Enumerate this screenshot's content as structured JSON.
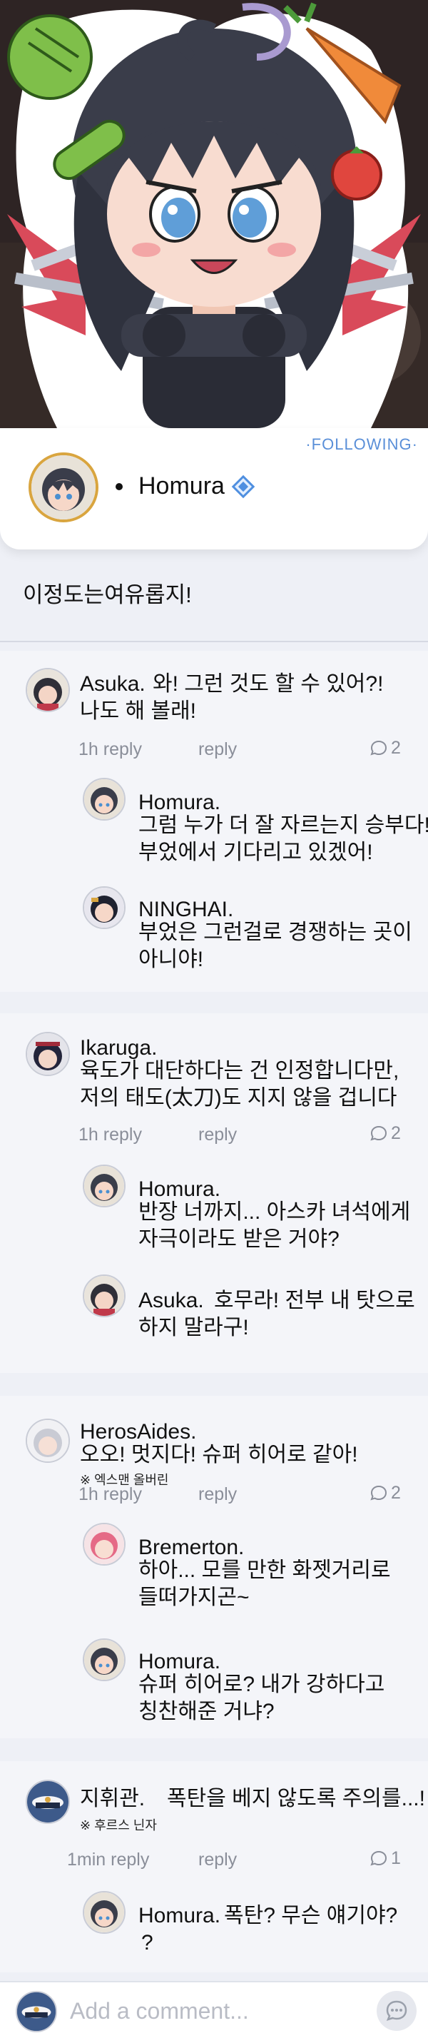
{
  "header": {
    "following_label": "·FOLLOWING·",
    "name": "Homura"
  },
  "post": {
    "text": "이정도는여유롭지!"
  },
  "threads": [
    {
      "comment": {
        "name": "Asuka.",
        "text_line1": "와! 그런 것도 할 수 있어?!",
        "text_line2": "나도 해 볼래!"
      },
      "time": "1h reply",
      "reply_label": "reply",
      "reply_count": "2",
      "replies": [
        {
          "name": "Homura.",
          "line1": "그럼 누가 더 잘 자르는지 승부다!",
          "line2": "부었에서 기다리고 있겠어!"
        },
        {
          "name": "NINGHAI.",
          "line1": "부었은 그런걸로 경쟁하는 곳이",
          "line2": "아니야!"
        }
      ]
    },
    {
      "comment": {
        "name": "Ikaruga.",
        "text_line1": "육도가 대단하다는 건 인정합니다만,",
        "text_line2": "저의 태도(太刀)도 지지 않을 겁니다"
      },
      "time": "1h reply",
      "reply_label": "reply",
      "reply_count": "2",
      "replies": [
        {
          "name": "Homura.",
          "line1": "반장 너까지... 아스카 녀석에게",
          "line2": "자극이라도 받은 거야?"
        },
        {
          "name": "Asuka.",
          "line1": "호무라! 전부 내 탓으로",
          "line2": "하지 말라구!"
        }
      ]
    },
    {
      "comment": {
        "name": "HerosAides.",
        "text_line1": "오오! 멋지다! 슈퍼 히어로 같아!",
        "note": "※ 엑스맨 올버린"
      },
      "time": "1h reply",
      "reply_label": "reply",
      "reply_count": "2",
      "replies": [
        {
          "name": "Bremerton.",
          "line1": "하아... 모를 만한 화젯거리로",
          "line2": "들떠가지곤~"
        },
        {
          "name": "Homura.",
          "line1": "슈퍼 히어로? 내가 강하다고",
          "line2": "칭찬해준 거냐?"
        }
      ]
    },
    {
      "comment": {
        "name": "지휘관.",
        "text_line1": "폭탄을 베지 않도록 주의를...!",
        "note": "※ 후르스 닌자"
      },
      "time": "1min reply",
      "reply_label": "reply",
      "reply_count": "1",
      "replies": [
        {
          "name": "Homura.",
          "line1": "폭탄? 무슨 얘기야?",
          "line2": "?"
        }
      ]
    }
  ],
  "composer": {
    "placeholder": "Add a comment..."
  },
  "colors": {
    "accent": "#5a8fd8",
    "meta": "#8a8e99",
    "avatar_ring": "#d9a53f"
  }
}
